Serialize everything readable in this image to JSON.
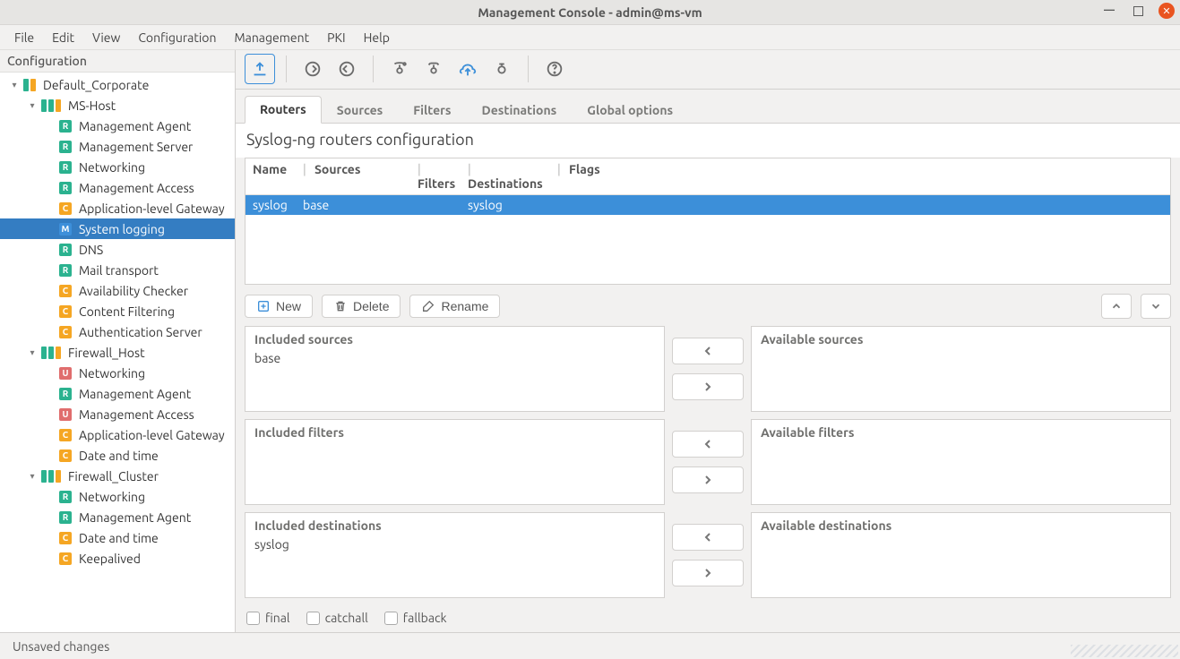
{
  "window": {
    "title": "Management Console - admin@ms-vm"
  },
  "menubar": [
    "File",
    "Edit",
    "View",
    "Configuration",
    "Management",
    "PKI",
    "Help"
  ],
  "tree": {
    "header": "Configuration",
    "nodes": [
      {
        "depth": 0,
        "expander": "▾",
        "icon": "group",
        "label": "Default_Corporate"
      },
      {
        "depth": 1,
        "expander": "▾",
        "icon": "group2",
        "label": "MS-Host"
      },
      {
        "depth": 2,
        "expander": "",
        "icon": "R",
        "label": "Management Agent"
      },
      {
        "depth": 2,
        "expander": "",
        "icon": "R",
        "label": "Management Server"
      },
      {
        "depth": 2,
        "expander": "",
        "icon": "R",
        "label": "Networking"
      },
      {
        "depth": 2,
        "expander": "",
        "icon": "R",
        "label": "Management Access"
      },
      {
        "depth": 2,
        "expander": "",
        "icon": "C",
        "label": "Application-level Gateway"
      },
      {
        "depth": 2,
        "expander": "",
        "icon": "M",
        "label": "System logging",
        "selected": true
      },
      {
        "depth": 2,
        "expander": "",
        "icon": "R",
        "label": "DNS"
      },
      {
        "depth": 2,
        "expander": "",
        "icon": "R",
        "label": "Mail transport"
      },
      {
        "depth": 2,
        "expander": "",
        "icon": "C",
        "label": "Availability Checker"
      },
      {
        "depth": 2,
        "expander": "",
        "icon": "C",
        "label": "Content Filtering"
      },
      {
        "depth": 2,
        "expander": "",
        "icon": "C",
        "label": "Authentication Server"
      },
      {
        "depth": 1,
        "expander": "▾",
        "icon": "group2",
        "label": "Firewall_Host"
      },
      {
        "depth": 2,
        "expander": "",
        "icon": "U",
        "label": "Networking"
      },
      {
        "depth": 2,
        "expander": "",
        "icon": "R",
        "label": "Management Agent"
      },
      {
        "depth": 2,
        "expander": "",
        "icon": "U",
        "label": "Management Access"
      },
      {
        "depth": 2,
        "expander": "",
        "icon": "C",
        "label": "Application-level Gateway"
      },
      {
        "depth": 2,
        "expander": "",
        "icon": "C",
        "label": "Date and time"
      },
      {
        "depth": 1,
        "expander": "▾",
        "icon": "group2",
        "label": "Firewall_Cluster"
      },
      {
        "depth": 2,
        "expander": "",
        "icon": "R",
        "label": "Networking"
      },
      {
        "depth": 2,
        "expander": "",
        "icon": "R",
        "label": "Management Agent"
      },
      {
        "depth": 2,
        "expander": "",
        "icon": "C",
        "label": "Date and time"
      },
      {
        "depth": 2,
        "expander": "",
        "icon": "C",
        "label": "Keepalived"
      }
    ]
  },
  "tabs": {
    "items": [
      "Routers",
      "Sources",
      "Filters",
      "Destinations",
      "Global options"
    ],
    "active": 0
  },
  "section_title": "Syslog-ng routers configuration",
  "routers_table": {
    "columns": [
      "Name",
      "Sources",
      "Filters",
      "Destinations",
      "Flags"
    ],
    "rows": [
      {
        "name": "syslog",
        "sources": "base",
        "filters": "",
        "destinations": "syslog",
        "flags": ""
      }
    ]
  },
  "actions": {
    "new": "New",
    "delete": "Delete",
    "rename": "Rename"
  },
  "transfers": [
    {
      "left_title": "Included sources",
      "left_items": [
        "base"
      ],
      "right_title": "Available sources",
      "right_items": []
    },
    {
      "left_title": "Included filters",
      "left_items": [],
      "right_title": "Available filters",
      "right_items": []
    },
    {
      "left_title": "Included destinations",
      "left_items": [
        "syslog"
      ],
      "right_title": "Available destinations",
      "right_items": []
    }
  ],
  "flags": {
    "final": "final",
    "catchall": "catchall",
    "fallback": "fallback"
  },
  "status": "Unsaved changes"
}
